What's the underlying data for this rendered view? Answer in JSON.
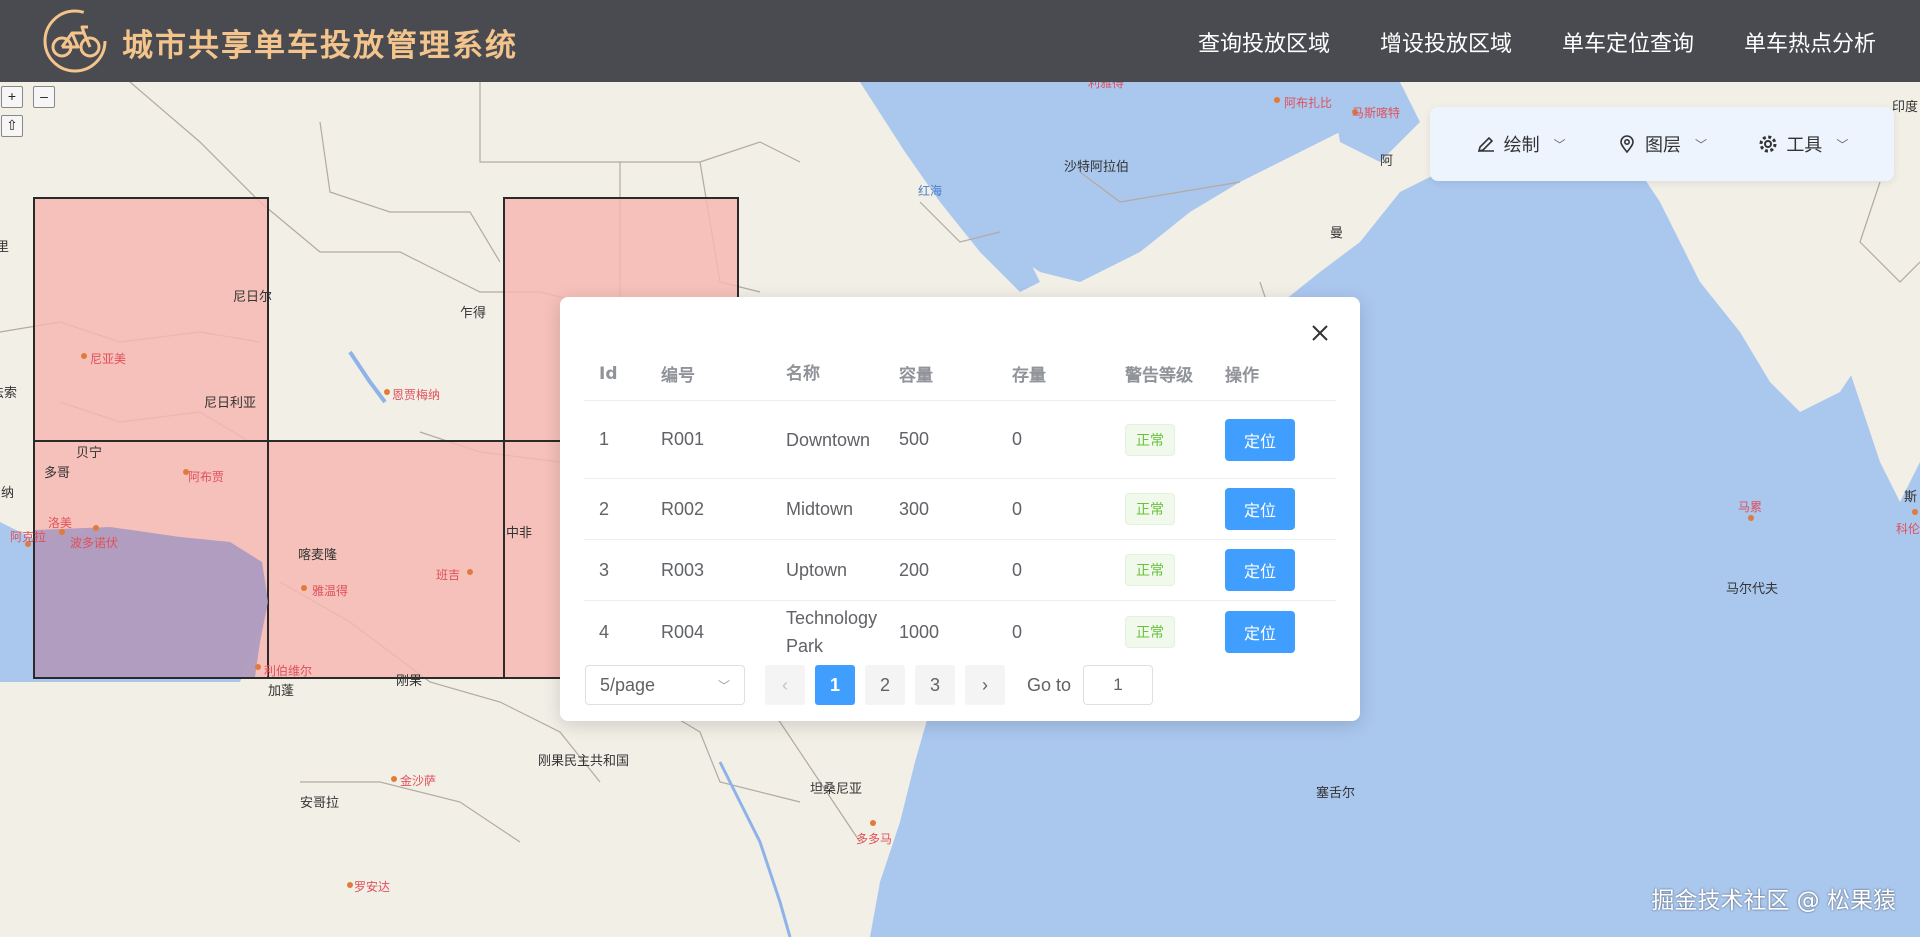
{
  "header": {
    "title": "城市共享单车投放管理系统",
    "nav": [
      "查询投放区域",
      "增设投放区域",
      "单车定位查询",
      "单车热点分析"
    ]
  },
  "map": {
    "labels": [
      {
        "text": "尼日尔",
        "kind": "country"
      },
      {
        "text": "乍得",
        "kind": "country"
      },
      {
        "text": "尼日利亚",
        "kind": "country"
      },
      {
        "text": "贝宁",
        "kind": "country"
      },
      {
        "text": "多哥",
        "kind": "country"
      },
      {
        "text": "布基纳法索",
        "kind": "country"
      },
      {
        "text": "加纳",
        "kind": "country"
      },
      {
        "text": "喀麦隆",
        "kind": "country"
      },
      {
        "text": "中非",
        "kind": "country"
      },
      {
        "text": "加蓬",
        "kind": "country"
      },
      {
        "text": "刚果",
        "kind": "country"
      },
      {
        "text": "刚果民主共和国",
        "kind": "country"
      },
      {
        "text": "安哥拉",
        "kind": "country"
      },
      {
        "text": "坦桑尼亚",
        "kind": "country"
      },
      {
        "text": "塞舌尔",
        "kind": "country"
      },
      {
        "text": "马尔代夫",
        "kind": "country"
      },
      {
        "text": "沙特阿拉伯",
        "kind": "country"
      },
      {
        "text": "阿",
        "kind": "country"
      },
      {
        "text": "曼",
        "kind": "country"
      },
      {
        "text": "印度",
        "kind": "country"
      },
      {
        "text": "斯",
        "kind": "country"
      },
      {
        "text": "里",
        "kind": "country"
      },
      {
        "text": "尼亚美",
        "kind": "city"
      },
      {
        "text": "阿布贾",
        "kind": "city"
      },
      {
        "text": "恩贾梅纳",
        "kind": "city"
      },
      {
        "text": "洛美",
        "kind": "city"
      },
      {
        "text": "波多诺伏",
        "kind": "city"
      },
      {
        "text": "阿克拉",
        "kind": "city"
      },
      {
        "text": "雅温得",
        "kind": "city"
      },
      {
        "text": "班吉",
        "kind": "city"
      },
      {
        "text": "利伯维尔",
        "kind": "city"
      },
      {
        "text": "金沙萨",
        "kind": "city"
      },
      {
        "text": "罗安达",
        "kind": "city"
      },
      {
        "text": "多多马",
        "kind": "city"
      },
      {
        "text": "马累",
        "kind": "city"
      },
      {
        "text": "科伦",
        "kind": "city"
      },
      {
        "text": "阿布扎比",
        "kind": "city"
      },
      {
        "text": "马斯喀特",
        "kind": "city"
      },
      {
        "text": "利雅得",
        "kind": "city"
      },
      {
        "text": "红海",
        "kind": "sea"
      }
    ]
  },
  "zoom": {
    "in": "+",
    "out": "–",
    "home": "⇧"
  },
  "toolbar": {
    "items": [
      {
        "label": "绘制",
        "icon": "pen-icon"
      },
      {
        "label": "图层",
        "icon": "location-pin-icon"
      },
      {
        "label": "工具",
        "icon": "gear-icon"
      }
    ]
  },
  "dialog": {
    "columns": [
      "Id",
      "编号",
      "名称",
      "容量",
      "存量",
      "警告等级",
      "操作"
    ],
    "rows": [
      {
        "id": "1",
        "code": "R001",
        "name": "Downtown",
        "capacity": "500",
        "stock": "0",
        "warning": "正常",
        "action": "定位"
      },
      {
        "id": "2",
        "code": "R002",
        "name": "Midtown",
        "capacity": "300",
        "stock": "0",
        "warning": "正常",
        "action": "定位"
      },
      {
        "id": "3",
        "code": "R003",
        "name": "Uptown",
        "capacity": "200",
        "stock": "0",
        "warning": "正常",
        "action": "定位"
      },
      {
        "id": "4",
        "code": "R004",
        "name": "Technology Park",
        "capacity": "1000",
        "stock": "0",
        "warning": "正常",
        "action": "定位"
      }
    ],
    "pagination": {
      "page_size": "5/page",
      "pages": [
        "1",
        "2",
        "3"
      ],
      "current": "1",
      "prev": "‹",
      "next": "›",
      "goto_label": "Go to",
      "goto_value": "1"
    }
  },
  "watermark": "掘金技术社区 @ 松果猿"
}
